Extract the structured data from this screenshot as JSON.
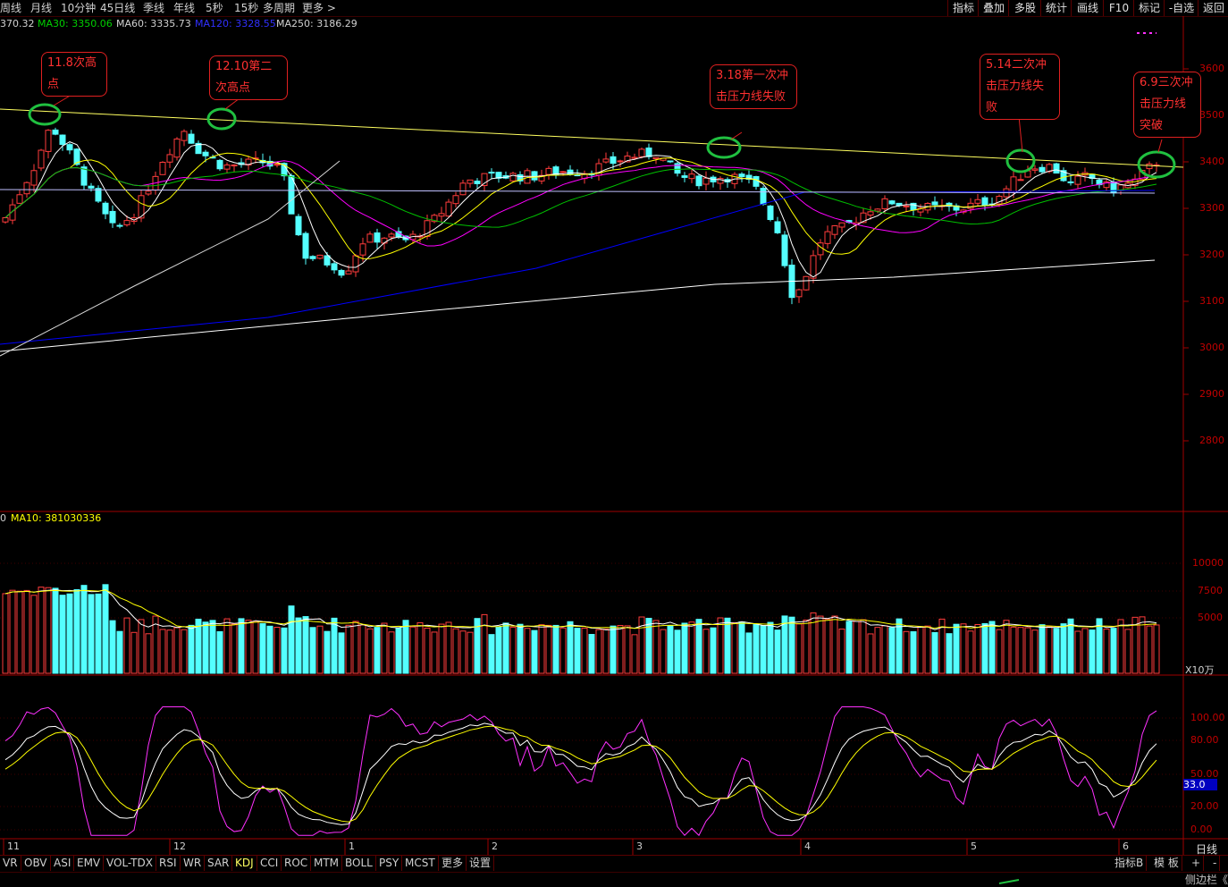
{
  "top_tabs": [
    "周线",
    "月线",
    "10分钟",
    "45日线",
    "季线",
    "年线",
    "5秒",
    "15秒",
    "多周期",
    "更多 >"
  ],
  "right_tabs": [
    "指标",
    "叠加",
    "多股",
    "统计",
    "画线",
    "F10",
    "标记",
    "-自选",
    "返回"
  ],
  "ma_line": {
    "ma_partial": "370.32",
    "ma30": "MA30: 3350.06",
    "ma60": "MA60: 3335.73",
    "ma120": "MA120: 3328.55",
    "ma250": "MA250: 3186.29"
  },
  "price_axis": [
    "3600",
    "3500",
    "3400",
    "3300",
    "3200",
    "3100",
    "3000",
    "2900",
    "2800"
  ],
  "callouts": {
    "c1": "11.8次高点",
    "c2": "12.10第二次高点",
    "c3": "3.18第一次冲击压力线失败",
    "c4": "5.14二次冲击压力线失败",
    "c5": "6.9三次冲击压力线突破"
  },
  "vol_header": {
    "prefix": "0",
    "ma10": "MA10: 381030336"
  },
  "vol_axis": [
    "10000",
    "7500",
    "5000"
  ],
  "vol_unit": "X10万",
  "kdj_axis": [
    "100.00",
    "80.00",
    "50.00",
    "20.00",
    "0.00"
  ],
  "kdj_badge": "33.0",
  "month_labels": [
    "11",
    "12",
    "1",
    "2",
    "3",
    "4",
    "5",
    "6"
  ],
  "period_label": "日线",
  "bottom_tabs": [
    "VR",
    "OBV",
    "ASI",
    "EMV",
    "VOL-TDX",
    "RSI",
    "WR",
    "SAR",
    "KDJ",
    "CCI",
    "ROC",
    "MTM",
    "BOLL",
    "PSY",
    "MCST",
    "更多",
    "设置"
  ],
  "bottom_right": [
    "指标B",
    "模 板",
    "+",
    "-"
  ],
  "sidebar_label": "侧边栏《",
  "colors": {
    "up": "#ff3c3c",
    "down": "#54ffff",
    "ma5": "#ffffff",
    "ma10": "#ffff00",
    "ma20": "#ff00ff",
    "ma30": "#00c000",
    "ma60": "#0000ff",
    "ma250": "#ffffff",
    "trendline": "#ffff60",
    "circle": "#20c040"
  }
}
